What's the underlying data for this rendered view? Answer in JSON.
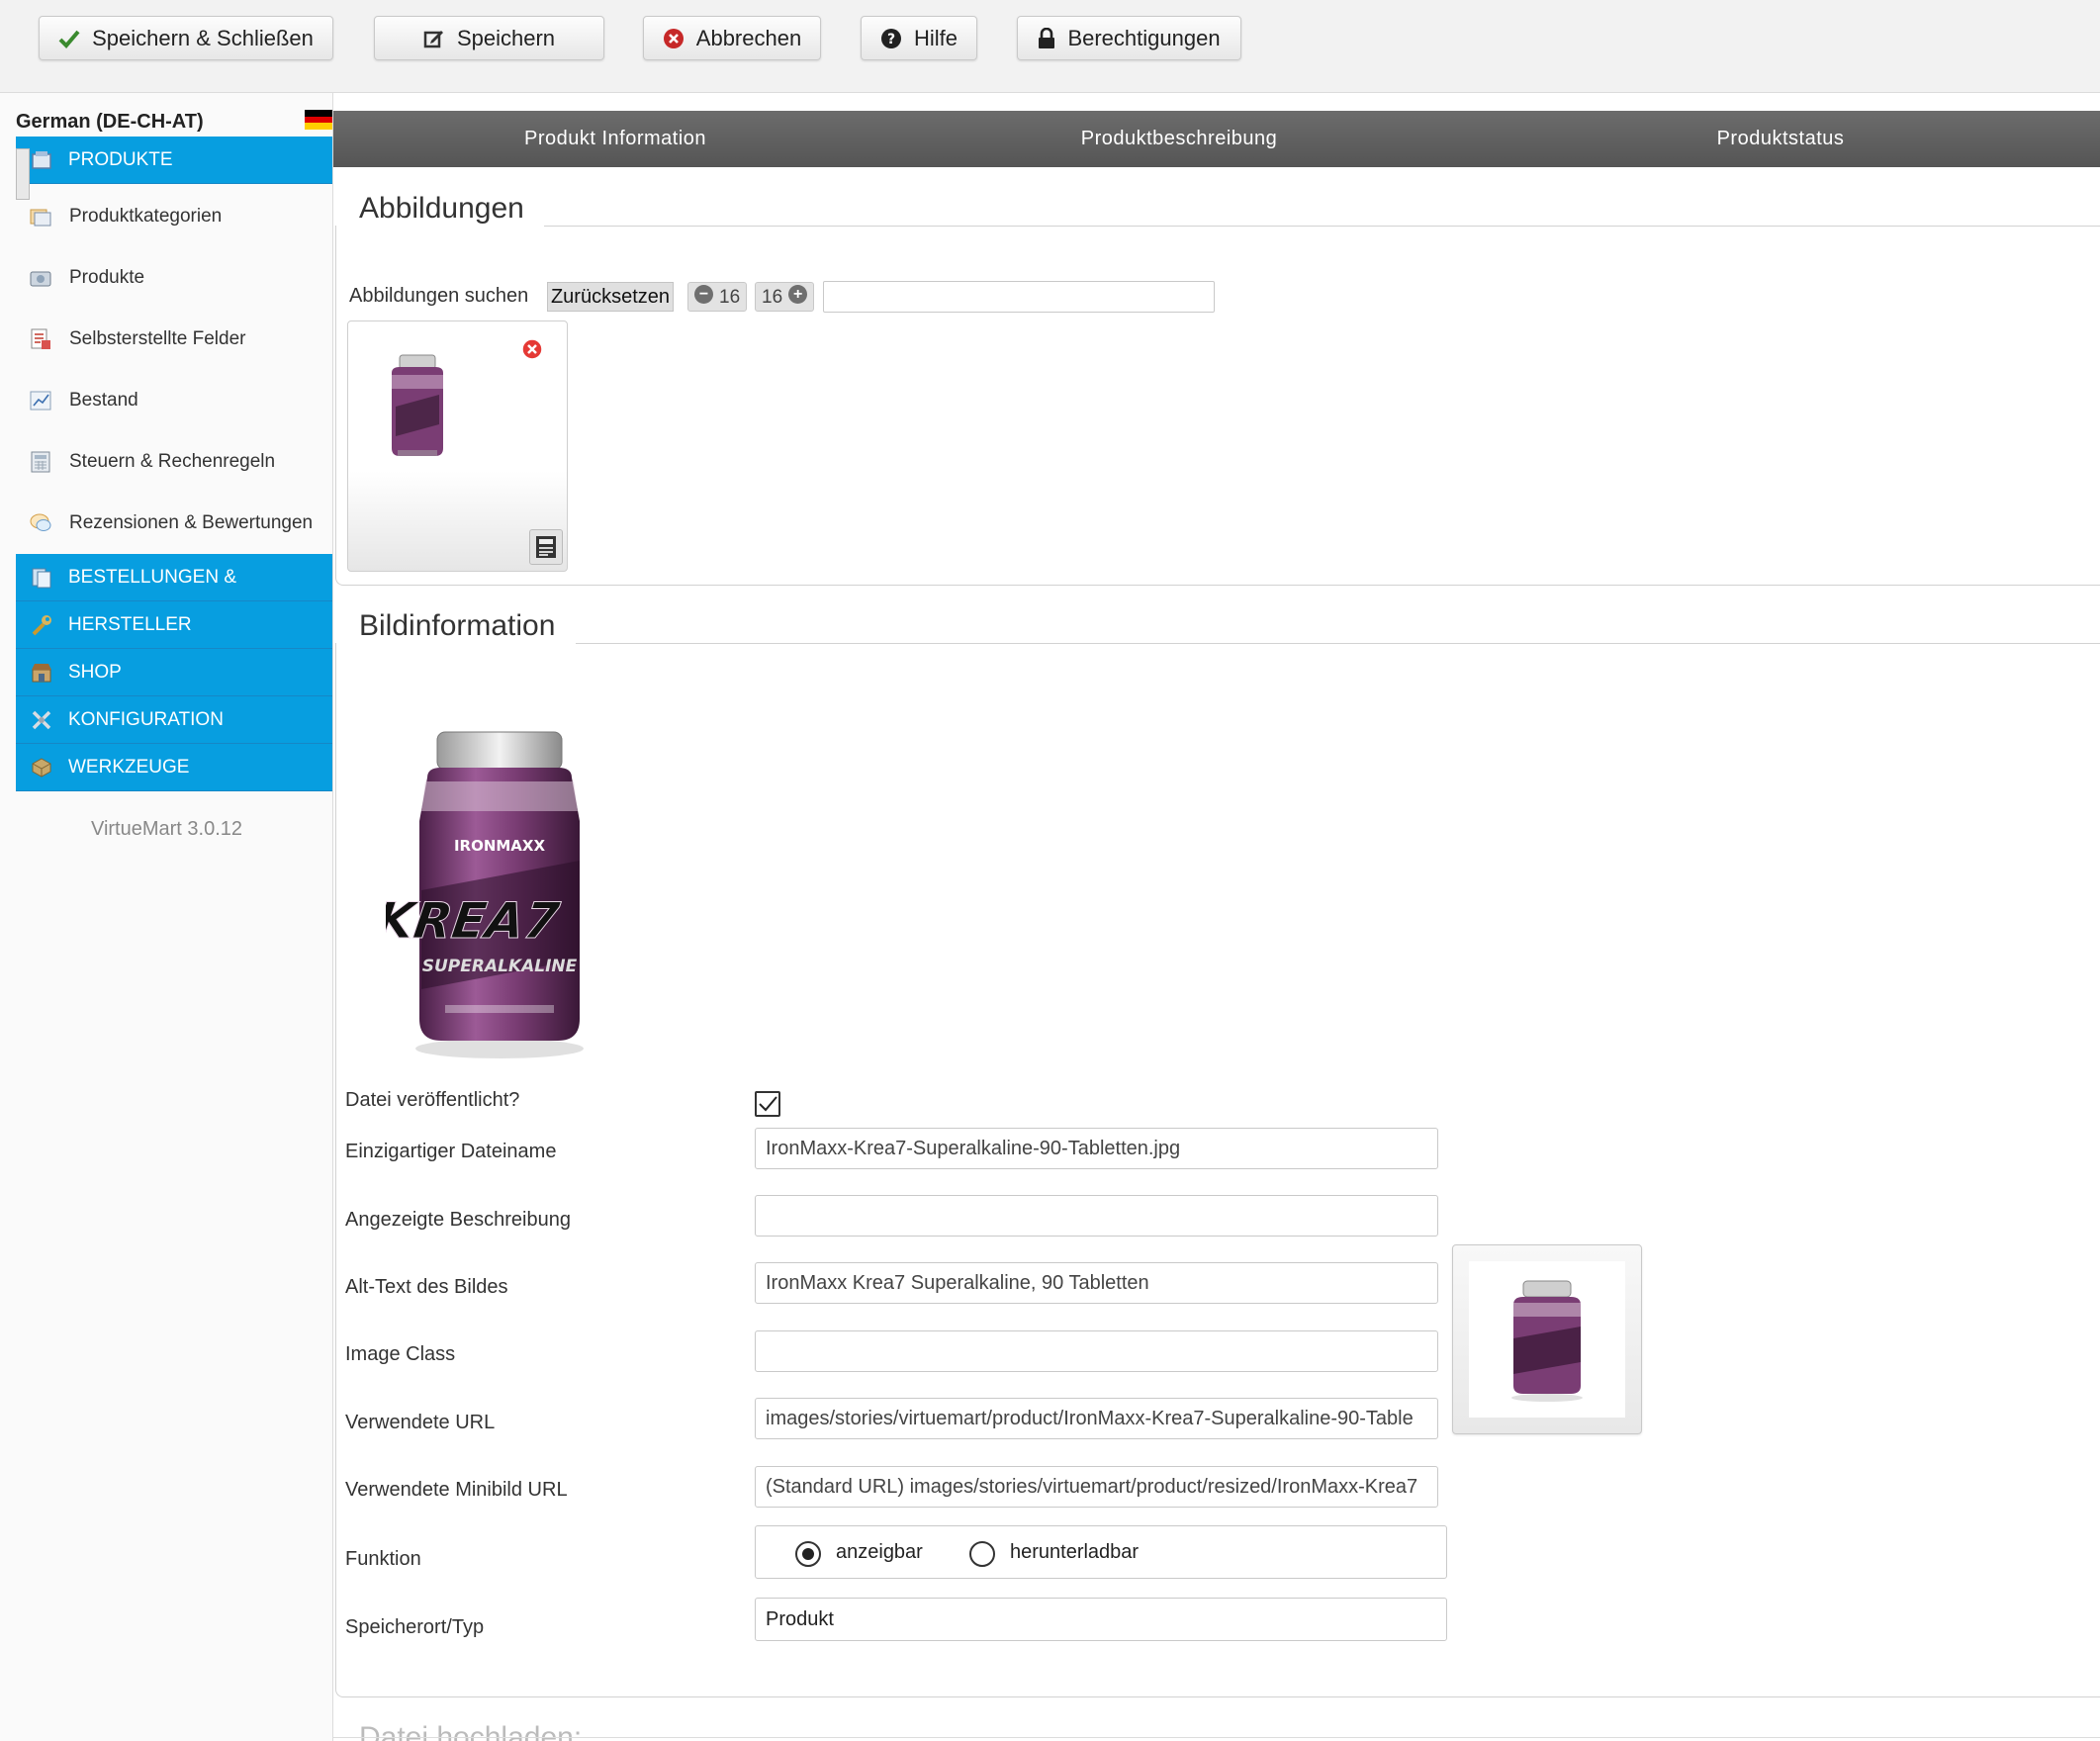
{
  "toolbar": {
    "save_close": "Speichern & Schließen",
    "save": "Speichern",
    "cancel": "Abbrechen",
    "help": "Hilfe",
    "permissions": "Berechtigungen"
  },
  "sidebar": {
    "language": "German (DE-CH-AT)",
    "sections": [
      {
        "label": "PRODUKTE",
        "icon": "products-section-icon"
      },
      {
        "label": "BESTELLUNGEN &",
        "icon": "orders-icon"
      },
      {
        "label": "HERSTELLER",
        "icon": "wrench-icon"
      },
      {
        "label": "SHOP",
        "icon": "shop-icon"
      },
      {
        "label": "KONFIGURATION",
        "icon": "configuration-icon"
      },
      {
        "label": "WERKZEUGE",
        "icon": "tools-icon"
      }
    ],
    "items": [
      {
        "label": "Produktkategorien",
        "icon": "categories-icon"
      },
      {
        "label": "Produkte",
        "icon": "product-icon"
      },
      {
        "label": "Selbsterstellte Felder",
        "icon": "custom-fields-icon"
      },
      {
        "label": "Bestand",
        "icon": "stock-chart-icon"
      },
      {
        "label": "Steuern & Rechenregeln",
        "icon": "tax-calculator-icon"
      },
      {
        "label": "Rezensionen & Bewertungen",
        "icon": "reviews-icon"
      }
    ],
    "version": "VirtueMart 3.0.12"
  },
  "tabs": [
    "Produkt Information",
    "Produktbeschreibung",
    "Produktstatus"
  ],
  "images_section": {
    "legend": "Abbildungen",
    "search_label": "Abbildungen suchen",
    "reset_button": "Zurücksetzen",
    "pager_minus_value": "16",
    "pager_plus_value": "16",
    "search_value": ""
  },
  "info_section": {
    "legend": "Bildinformation",
    "fields": {
      "published_label": "Datei veröffentlicht?",
      "published_checked": true,
      "filename_label": "Einzigartiger Dateiname",
      "filename_value": "IronMaxx-Krea7-Superalkaline-90-Tabletten.jpg",
      "description_label": "Angezeigte Beschreibung",
      "description_value": "",
      "alt_label": "Alt-Text des Bildes",
      "alt_value": "IronMaxx Krea7 Superalkaline, 90 Tabletten",
      "class_label": "Image Class",
      "class_value": "",
      "url_label": "Verwendete URL",
      "url_value": "images/stories/virtuemart/product/IronMaxx-Krea7-Superalkaline-90-Table",
      "thumb_url_label": "Verwendete Minibild URL",
      "thumb_url_value": "(Standard URL) images/stories/virtuemart/product/resized/IronMaxx-Krea7",
      "function_label": "Funktion",
      "function_options": [
        "anzeigbar",
        "herunterladbar"
      ],
      "function_selected": "anzeigbar",
      "location_label": "Speicherort/Typ",
      "location_value": "Produkt"
    }
  },
  "upload_section": {
    "legend": "Datei hochladen:"
  },
  "product": {
    "brand": "IRONMAXX",
    "name_line1": "KREA7",
    "name_line2": "SUPERALKALINE"
  },
  "colors": {
    "accent": "#079ee0",
    "tab_bar": "#5e5e5e",
    "check_green": "#3a8a2e",
    "cancel_red": "#c62828",
    "product_purple": "#7a3d74"
  }
}
